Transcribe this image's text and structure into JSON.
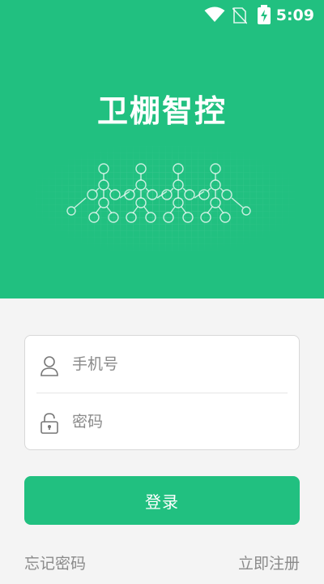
{
  "status_bar": {
    "time": "5:09",
    "icons": [
      "wifi-icon",
      "no-sim-icon",
      "battery-charging-icon"
    ]
  },
  "app": {
    "title": "卫棚智控"
  },
  "form": {
    "phone_placeholder": "手机号",
    "password_placeholder": "密码",
    "phone_icon": "user-icon",
    "password_icon": "lock-icon"
  },
  "actions": {
    "login_label": "登录",
    "forgot_password_label": "忘记密码",
    "register_label": "立即注册"
  },
  "colors": {
    "brand": "#21c080",
    "background": "#f4f4f4",
    "muted_text": "#8a8a8a"
  }
}
